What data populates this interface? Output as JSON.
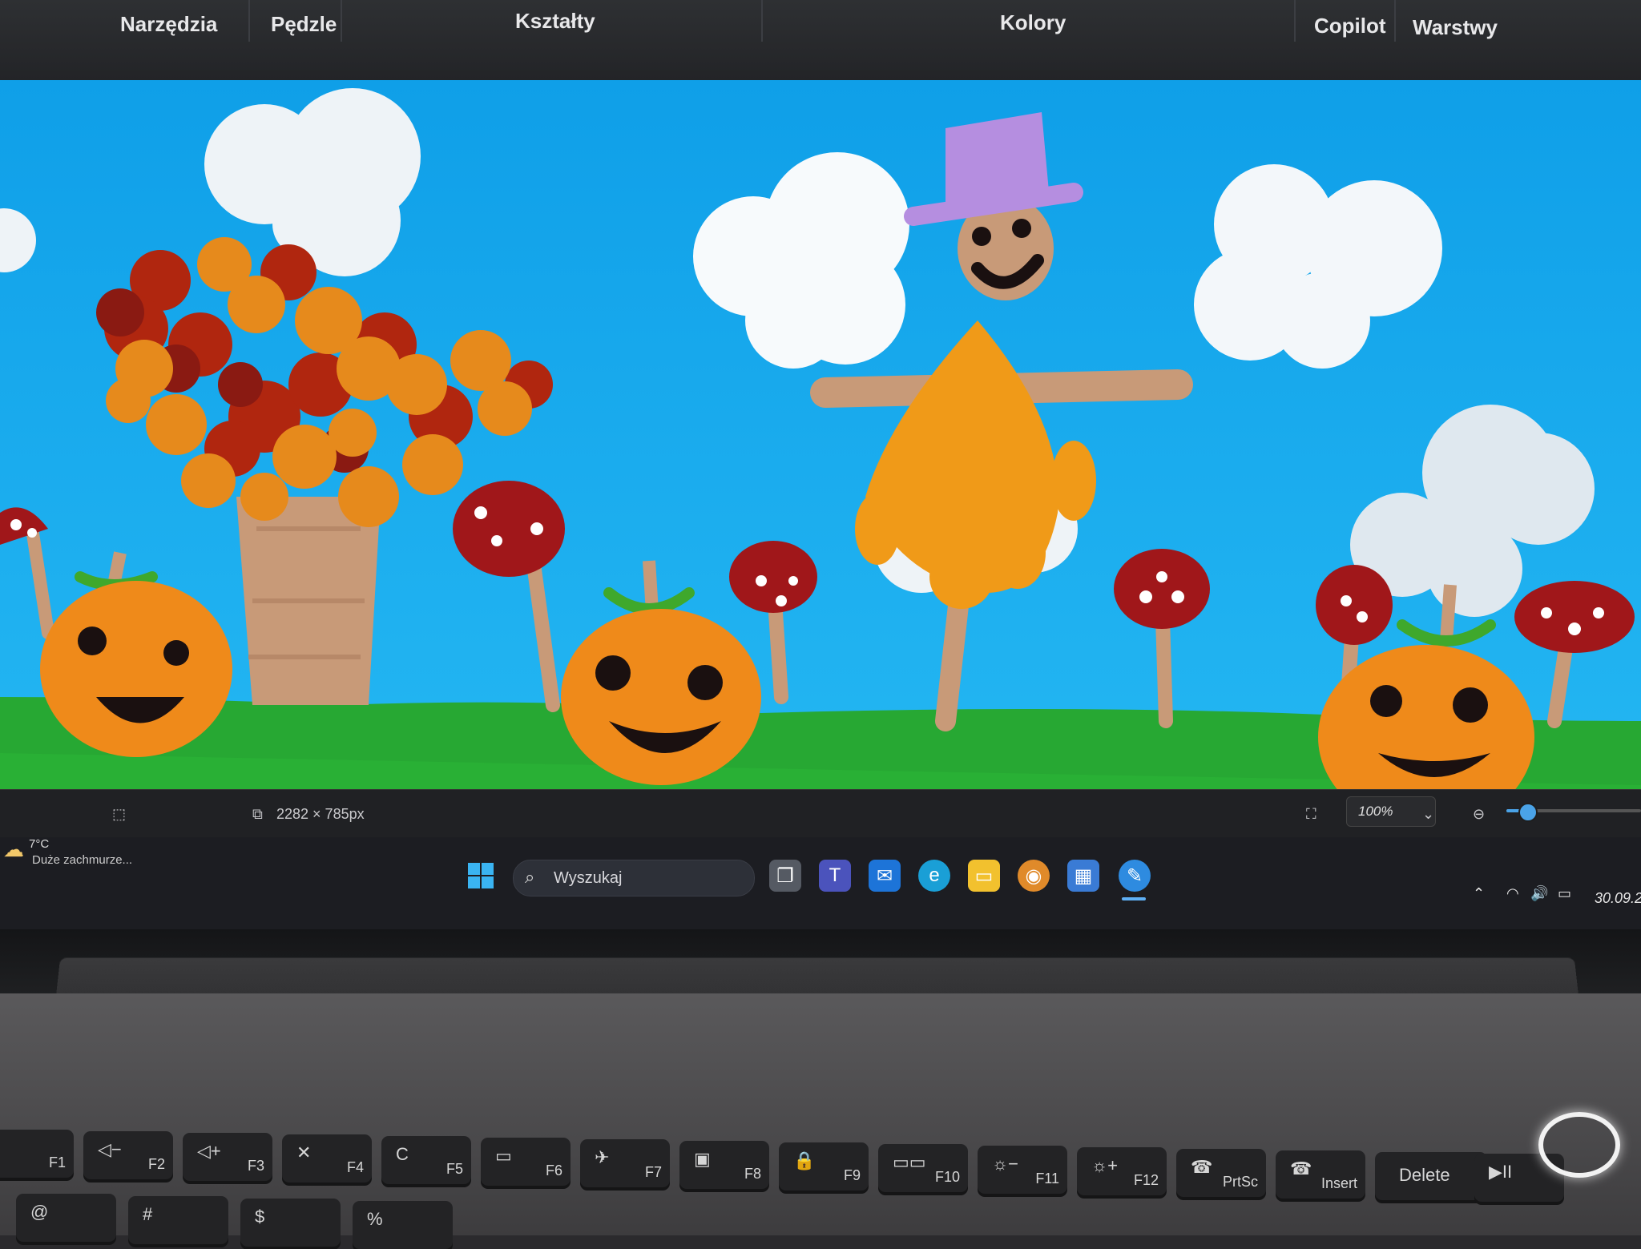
{
  "ribbon": {
    "tools": "Narzędzia",
    "brushes": "Pędzle",
    "shapes": "Kształty",
    "colors": "Kolory",
    "copilot": "Copilot",
    "layers": "Warstwy"
  },
  "statusbar": {
    "canvas_size": "2282 × 785px",
    "zoom": "100%",
    "zoom_fraction": 0.15
  },
  "weather": {
    "temp": "7°C",
    "desc": "Duże zachmurze..."
  },
  "taskbar": {
    "search_placeholder": "Wyszukaj",
    "icons": [
      "windows-start-icon",
      "task-view-icon",
      "teams-icon",
      "mail-icon",
      "edge-icon",
      "file-explorer-icon",
      "chrome-canary-icon",
      "store-icon",
      "paint-icon"
    ]
  },
  "tray": {
    "date": "30.09.2"
  },
  "keyboard": {
    "keys": [
      {
        "label": "F1"
      },
      {
        "label": "F2",
        "glyph": "◁−"
      },
      {
        "label": "F3",
        "glyph": "◁+"
      },
      {
        "label": "F4",
        "glyph": "✕"
      },
      {
        "label": "F5",
        "glyph": "C"
      },
      {
        "label": "F6",
        "glyph": "▭"
      },
      {
        "label": "F7",
        "glyph": "✈"
      },
      {
        "label": "F8",
        "glyph": "▣"
      },
      {
        "label": "F9",
        "glyph": "🔒"
      },
      {
        "label": "F10",
        "glyph": "▭▭"
      },
      {
        "label": "F11",
        "glyph": "☼−"
      },
      {
        "label": "F12",
        "glyph": "☼+"
      },
      {
        "label": "PrtSc",
        "glyph": "☎"
      },
      {
        "label": "Insert",
        "glyph": "☎"
      },
      {
        "label": "Delete"
      },
      {
        "label": "",
        "glyph": "▶II"
      }
    ],
    "row2": [
      {
        "glyph": "@"
      },
      {
        "glyph": "#"
      },
      {
        "glyph": "$"
      },
      {
        "glyph": "%"
      }
    ]
  },
  "colors": {
    "sky_top": "#0f9fe8",
    "sky_bottom": "#22b6f2",
    "grass": "#27a833",
    "pumpkin": "#ef8a1a",
    "mushroom_cap": "#a0171a",
    "scarecrow_hat": "#b58ee0",
    "cloud": "#eef3f7",
    "tree_trunk": "#c89a78"
  }
}
